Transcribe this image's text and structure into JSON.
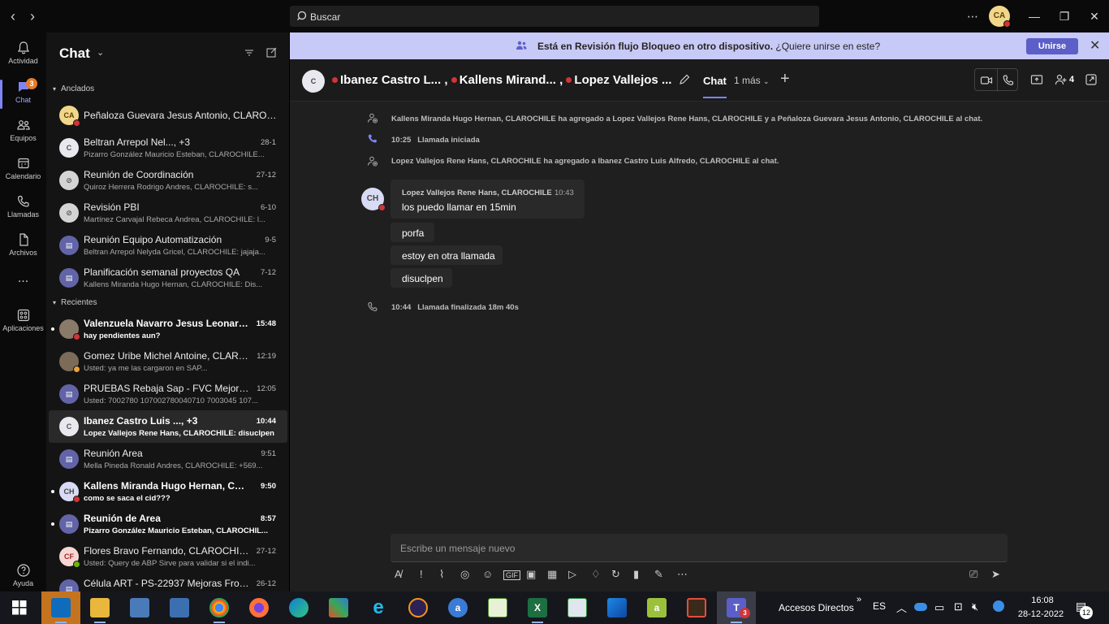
{
  "titlebar": {
    "search_placeholder": "Buscar",
    "user_initials": "CA"
  },
  "rail": {
    "items": [
      {
        "label": "Actividad",
        "icon": "bell-icon"
      },
      {
        "label": "Chat",
        "icon": "chat-icon",
        "badge": "3"
      },
      {
        "label": "Equipos",
        "icon": "teams-icon"
      },
      {
        "label": "Calendario",
        "icon": "calendar-icon"
      },
      {
        "label": "Llamadas",
        "icon": "phone-icon"
      },
      {
        "label": "Archivos",
        "icon": "file-icon"
      },
      {
        "label": "...",
        "icon": "more-icon"
      },
      {
        "label": "Aplicaciones",
        "icon": "apps-icon"
      },
      {
        "label": "Ayuda",
        "icon": "help-icon"
      }
    ]
  },
  "chatpane": {
    "title": "Chat",
    "pinned_label": "Anclados",
    "recent_label": "Recientes",
    "pinned": [
      {
        "initials": "CA",
        "name": "Peñaloza Guevara Jesus Antonio, CLAROC...",
        "preview": "",
        "time": ""
      },
      {
        "initials": "C",
        "name": "Beltran Arrepol Nel..., +3",
        "preview": "Pizarro González Mauricio Esteban, CLAROCHILE...",
        "time": "28-1"
      },
      {
        "initials": "",
        "name": "Reunión de Coordinación",
        "preview": "Quiroz Herrera Rodrigo Andres, CLAROCHILE: s...",
        "time": "27-12"
      },
      {
        "initials": "",
        "name": "Revisión PBI",
        "preview": "Martínez Carvajal Rebeca Andrea, CLAROCHILE: l...",
        "time": "6-10"
      },
      {
        "initials": "",
        "name": "Reunión Equipo Automatización",
        "preview": "Beltran Arrepol Nelyda Gricel, CLAROCHILE: jajaja...",
        "time": "9-5"
      },
      {
        "initials": "",
        "name": "Planificación semanal proyectos QA",
        "preview": "Kallens Miranda Hugo Hernan, CLAROCHILE: Dis...",
        "time": "7-12"
      }
    ],
    "recent": [
      {
        "initials": "",
        "name": "Valenzuela Navarro Jesus Leonardo...",
        "preview": "hay pendientes aun?",
        "time": "15:48"
      },
      {
        "initials": "",
        "name": "Gomez Uribe Michel Antoine, CLARO...",
        "preview": "Usted: ya me las cargaron en SAP...",
        "time": "12:19"
      },
      {
        "initials": "",
        "name": "PRUEBAS Rebaja Sap - FVC Mejoras Fl...",
        "preview": "Usted: 7002780 107002780040710 7003045 107...",
        "time": "12:05"
      },
      {
        "initials": "C",
        "name": "Ibanez Castro Luis ..., +3",
        "preview": "Lopez Vallejos Rene Hans, CLAROCHILE: disuclpen",
        "time": "10:44"
      },
      {
        "initials": "",
        "name": "Reunión Area",
        "preview": "Mella Pineda Ronald Andres, CLAROCHILE: +569...",
        "time": "9:51"
      },
      {
        "initials": "CH",
        "name": "Kallens Miranda Hugo Hernan, CLA...",
        "preview": "como se saca el cid???",
        "time": "9:50"
      },
      {
        "initials": "",
        "name": "Reunión de Area",
        "preview": "Pizarro González Mauricio Esteban, CLAROCHIL...",
        "time": "8:57"
      },
      {
        "initials": "CF",
        "name": "Flores Bravo Fernando, CLAROCHILE",
        "preview": "Usted: Query de ABP Sirve para validar si el indi...",
        "time": "27-12"
      },
      {
        "initials": "",
        "name": "Célula ART - PS-22937 Mejoras Front ...",
        "preview": "",
        "time": "26-12"
      }
    ]
  },
  "banner": {
    "message": "Está en Revisión flujo Bloqueo en otro dispositivo.",
    "question": "¿Quiere unirse en este?",
    "button": "Unirse"
  },
  "chathead": {
    "group_initials": "C",
    "name1": "Ibanez Castro L... ,",
    "name2": "Kallens Mirand... ,",
    "name3": "Lopez Vallejos ...",
    "tab_chat": "Chat",
    "tab_more": "1 más",
    "people_count": "4"
  },
  "messages": {
    "sys1": "Kallens Miranda Hugo Hernan, CLAROCHILE ha agregado a Lopez Vallejos Rene Hans, CLAROCHILE y a Peñaloza Guevara Jesus Antonio, CLAROCHILE al chat.",
    "call_start_time": "10:25",
    "call_start_label": "Llamada iniciada",
    "sys2": "Lopez Vallejos Rene Hans, CLAROCHILE ha agregado a Ibanez Castro Luis Alfredo, CLAROCHILE al chat.",
    "sender_initials": "CH",
    "sender": "Lopez Vallejos Rene Hans, CLAROCHILE",
    "sender_time": "10:43",
    "m1": "los puedo llamar en 15min",
    "m2": "porfa",
    "m3": "estoy en otra llamada",
    "m4": "disuclpen",
    "call_end_time": "10:44",
    "call_end_label": "Llamada finalizada",
    "call_duration": "18m 40s"
  },
  "compose": {
    "placeholder": "Escribe un mensaje nuevo"
  },
  "taskbar": {
    "accesos": "Accesos Directos",
    "lang": "ES",
    "time": "16:08",
    "date": "28-12-2022",
    "notif_count": "12",
    "teams_badge": "3"
  }
}
